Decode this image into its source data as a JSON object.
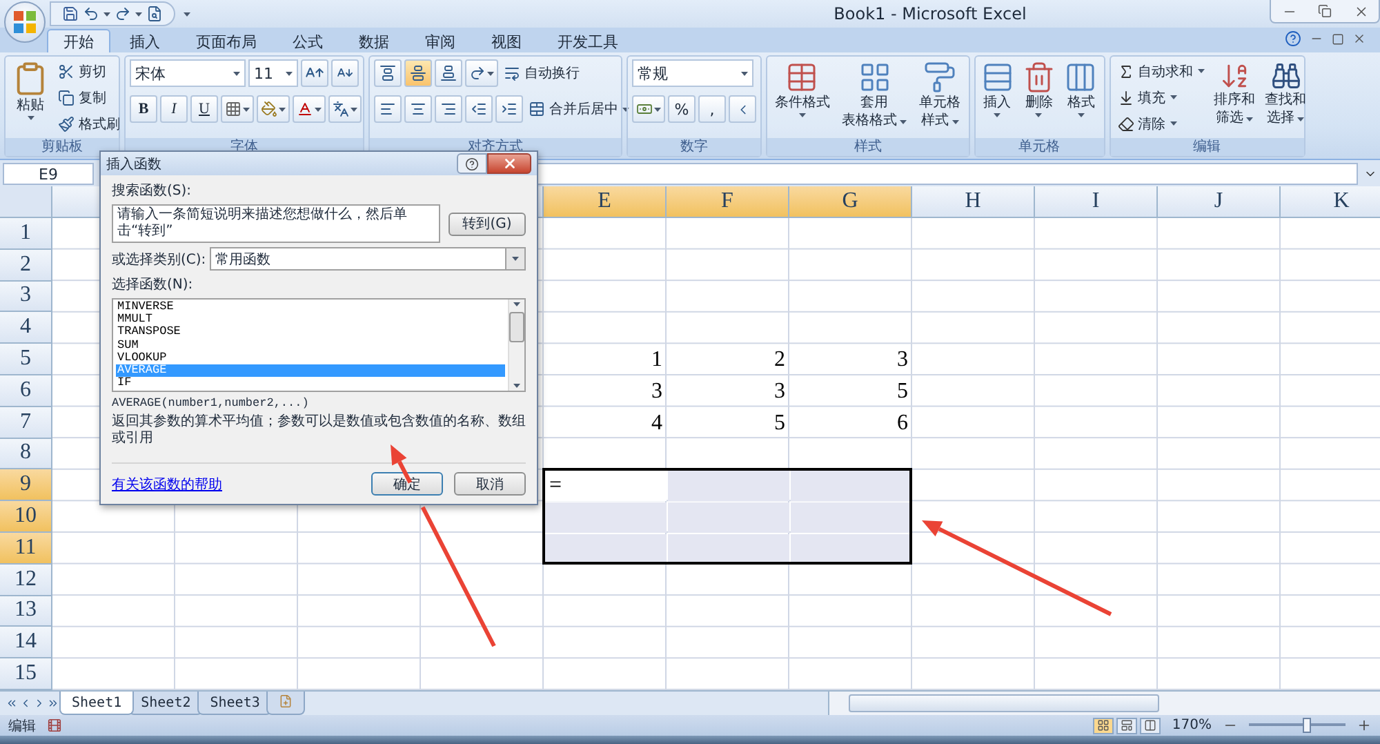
{
  "window": {
    "title": "Book1 - Microsoft Excel"
  },
  "ribbon_tabs": [
    {
      "label": "开始",
      "selected": true
    },
    {
      "label": "插入",
      "selected": false
    },
    {
      "label": "页面布局",
      "selected": false
    },
    {
      "label": "公式",
      "selected": false
    },
    {
      "label": "数据",
      "selected": false
    },
    {
      "label": "审阅",
      "selected": false
    },
    {
      "label": "视图",
      "selected": false
    },
    {
      "label": "开发工具",
      "selected": false
    }
  ],
  "ribbon_groups": [
    {
      "kind": "clipboard",
      "label": "剪贴板",
      "large": "粘贴",
      "small": [
        "剪切",
        "复制",
        "格式刷"
      ]
    },
    {
      "kind": "font",
      "label": "字体",
      "font": "宋体",
      "size": "11",
      "styles": [
        "B",
        "I",
        "U"
      ]
    },
    {
      "kind": "align",
      "label": "对齐方式",
      "vertical_align": [
        {
          "selected": false
        },
        {
          "selected": true
        },
        {
          "selected": false
        }
      ],
      "wrap": "自动换行",
      "merge": "合并后居中"
    },
    {
      "kind": "number",
      "label": "数字",
      "format": "常规",
      "symbols": [
        "%",
        ","
      ]
    },
    {
      "kind": "large_buttons",
      "label": "样式",
      "buttons": [
        [
          "条件格式"
        ],
        [
          "套用",
          "表格格式"
        ],
        [
          "单元格",
          "样式"
        ]
      ]
    },
    {
      "kind": "large_buttons",
      "label": "单元格",
      "buttons": [
        [
          "插入"
        ],
        [
          "删除"
        ],
        [
          "格式"
        ]
      ]
    },
    {
      "kind": "editing",
      "label": "编辑",
      "small": [
        "自动求和",
        "填充",
        "清除"
      ],
      "large": [
        [
          "排序和",
          "筛选"
        ],
        [
          "查找和",
          "选择"
        ]
      ]
    }
  ],
  "name_box": "E9",
  "sheet": {
    "columns": [
      {
        "label": "E",
        "selected": true
      },
      {
        "label": "F",
        "selected": true
      },
      {
        "label": "G",
        "selected": true
      },
      {
        "label": "H",
        "selected": false
      },
      {
        "label": "I",
        "selected": false
      },
      {
        "label": "J",
        "selected": false
      },
      {
        "label": "K",
        "selected": false
      }
    ],
    "rows": [
      {
        "label": "1",
        "selected": false
      },
      {
        "label": "2",
        "selected": false
      },
      {
        "label": "3",
        "selected": false
      },
      {
        "label": "4",
        "selected": false
      },
      {
        "label": "5",
        "selected": false,
        "cells": [
          {
            "value": "1",
            "kind": "number"
          },
          {
            "value": "2",
            "kind": "number"
          },
          {
            "value": "3",
            "kind": "number"
          }
        ]
      },
      {
        "label": "6",
        "selected": false,
        "cells": [
          {
            "value": "3",
            "kind": "number"
          },
          {
            "value": "3",
            "kind": "number"
          },
          {
            "value": "5",
            "kind": "number"
          }
        ]
      },
      {
        "label": "7",
        "selected": false,
        "cells": [
          {
            "value": "4",
            "kind": "number"
          },
          {
            "value": "5",
            "kind": "number"
          },
          {
            "value": "6",
            "kind": "number"
          }
        ]
      },
      {
        "label": "8",
        "selected": false
      },
      {
        "label": "9",
        "selected": true,
        "cells": [
          {
            "value": "=",
            "kind": "text",
            "active": true
          }
        ]
      },
      {
        "label": "10",
        "selected": true
      },
      {
        "label": "11",
        "selected": true
      },
      {
        "label": "12",
        "selected": false
      },
      {
        "label": "13",
        "selected": false
      },
      {
        "label": "14",
        "selected": false
      },
      {
        "label": "15",
        "selected": false
      }
    ]
  },
  "sheet_tabs": [
    {
      "label": "Sheet1",
      "selected": true
    },
    {
      "label": "Sheet2",
      "selected": false
    },
    {
      "label": "Sheet3",
      "selected": false
    }
  ],
  "status_bar": {
    "mode": "编辑",
    "view_buttons": [
      {
        "selected": true
      },
      {
        "selected": false
      },
      {
        "selected": false
      }
    ],
    "zoom": "170%",
    "zoom_slider": {
      "level": 0.6
    }
  },
  "dialog": {
    "title": "插入函数",
    "search_label": "搜索函数(S):",
    "search_value": "请输入一条简短说明来描述您想做什么，然后单击“转到”",
    "go_button": "转到(G)",
    "category_label": "或选择类别(C):",
    "category_value": "常用函数",
    "function_label": "选择函数(N):",
    "functions": [
      {
        "label": "MINVERSE",
        "selected": false
      },
      {
        "label": "MMULT",
        "selected": false
      },
      {
        "label": "TRANSPOSE",
        "selected": false
      },
      {
        "label": "SUM",
        "selected": false
      },
      {
        "label": "VLOOKUP",
        "selected": false
      },
      {
        "label": "AVERAGE",
        "selected": true
      },
      {
        "label": "IF",
        "selected": false
      }
    ],
    "syntax": "AVERAGE(number1,number2,...)",
    "description": "返回其参数的算术平均值；参数可以是数值或包含数值的名称、数组或引用",
    "help_link": "有关该函数的帮助",
    "ok_button": "确定",
    "cancel_button": "取消"
  }
}
